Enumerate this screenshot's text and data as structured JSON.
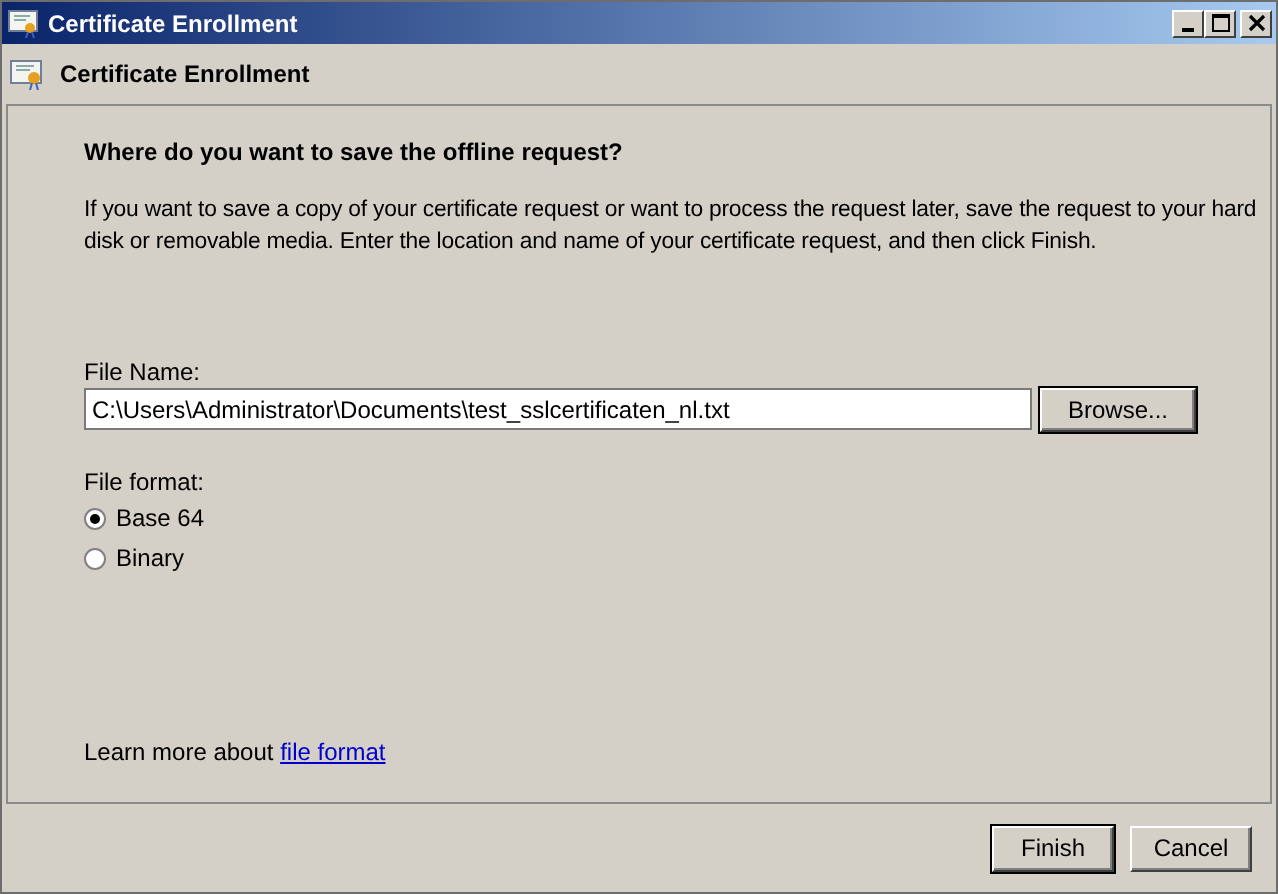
{
  "window": {
    "title": "Certificate Enrollment"
  },
  "header": {
    "title": "Certificate Enrollment"
  },
  "heading": "Where do you want to save the offline request?",
  "description": "If you want to save a copy of your certificate request or want to process the request later, save the request to your hard disk or removable media. Enter the location and name of your certificate request, and then click Finish.",
  "file_name": {
    "label": "File Name:",
    "value": "C:\\Users\\Administrator\\Documents\\test_sslcertificaten_nl.txt",
    "browse": "Browse..."
  },
  "file_format": {
    "label": "File format:",
    "options": [
      {
        "label": "Base 64",
        "selected": true
      },
      {
        "label": "Binary",
        "selected": false
      }
    ]
  },
  "learn_more": {
    "text": "Learn more about ",
    "link": "file format"
  },
  "buttons": [
    "Finish",
    "Cancel"
  ]
}
